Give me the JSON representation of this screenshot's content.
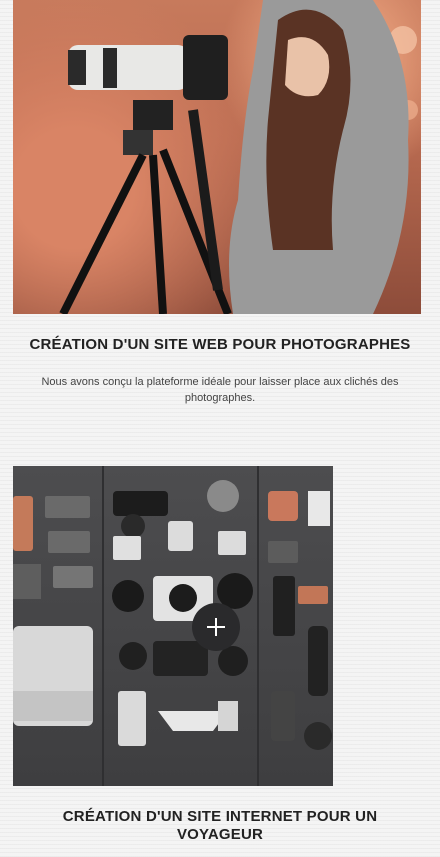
{
  "items": [
    {
      "title": "CRÉATION D'UN SITE WEB POUR PHOTOGRAPHES",
      "description": "Nous avons conçu la plateforme idéale pour laisser place aux clichés des photographes."
    },
    {
      "title": "CRÉATION D'UN SITE INTERNET POUR UN VOYAGEUR"
    }
  ],
  "icons": {
    "overlay": "plus-icon"
  },
  "colors": {
    "title": "#222222",
    "text": "#444444",
    "overlay_button": "#2a2a2c"
  }
}
